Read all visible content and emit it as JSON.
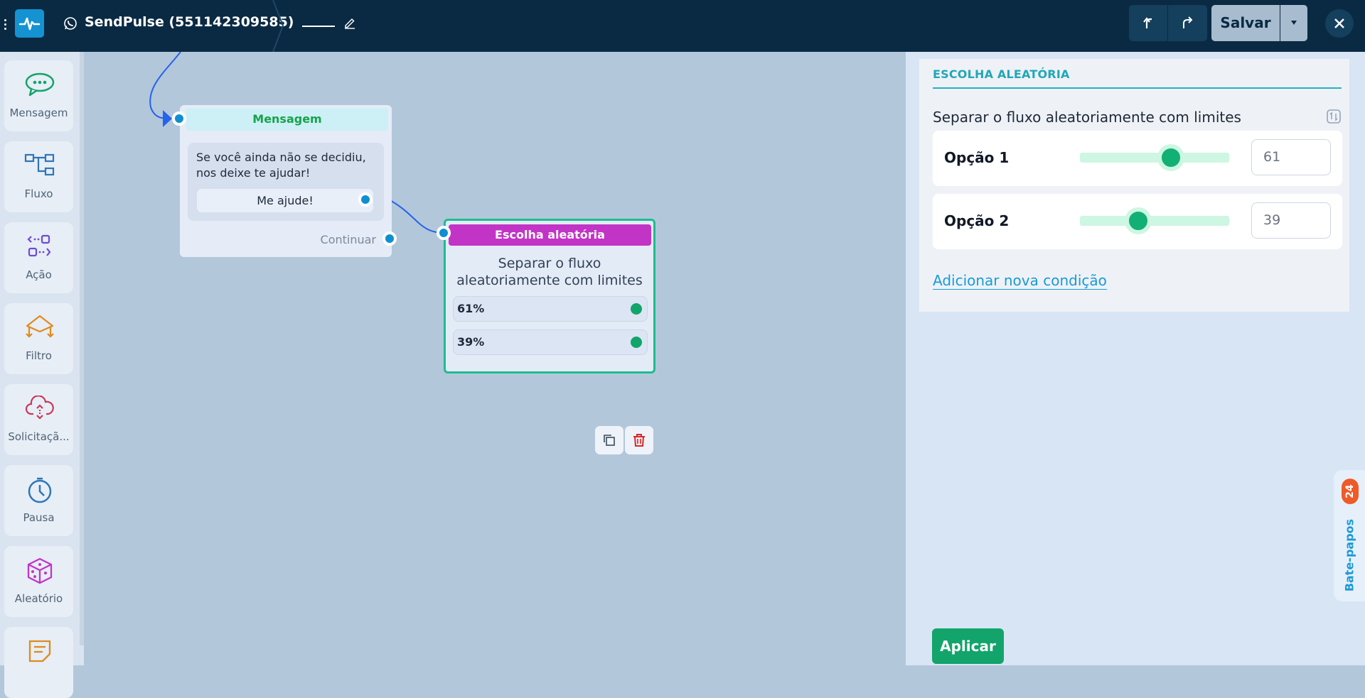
{
  "header": {
    "bot_name": "SendPulse (551142309585)",
    "save_label": "Salvar"
  },
  "sidebar": {
    "tools": [
      {
        "label": "Mensagem",
        "icon": "chat-bubble-icon"
      },
      {
        "label": "Fluxo",
        "icon": "flow-icon"
      },
      {
        "label": "Ação",
        "icon": "action-icon"
      },
      {
        "label": "Filtro",
        "icon": "filter-icon"
      },
      {
        "label": "Solicitaçã...",
        "icon": "cloud-request-icon"
      },
      {
        "label": "Pausa",
        "icon": "timer-icon"
      },
      {
        "label": "Aleatório",
        "icon": "dice-icon"
      },
      {
        "label": "",
        "icon": "note-icon"
      }
    ]
  },
  "canvas": {
    "message_node": {
      "title": "Mensagem",
      "text": "Se você ainda não se decidiu, nos deixe te ajudar!",
      "button": "Me ajude!",
      "continue_label": "Continuar"
    },
    "random_node": {
      "title": "Escolha aleatória",
      "description": "Separar o fluxo aleatoriamente com limites",
      "options": [
        "61%",
        "39%"
      ]
    }
  },
  "panel": {
    "title": "ESCOLHA ALEATÓRIA",
    "description": "Separar o fluxo aleatoriamente com limites",
    "options": [
      {
        "label": "Opção 1",
        "value": "61",
        "fraction": 0.61
      },
      {
        "label": "Opção 2",
        "value": "39",
        "fraction": 0.39
      }
    ],
    "add_condition": "Adicionar nova condição",
    "apply": "Aplicar"
  },
  "chats": {
    "label": "Bate-papos",
    "count": "24"
  },
  "colors": {
    "topbar": "#0a2a43",
    "accent_green": "#12a46b",
    "random_node": "#c234c6",
    "link_blue": "#1a9ad6"
  }
}
